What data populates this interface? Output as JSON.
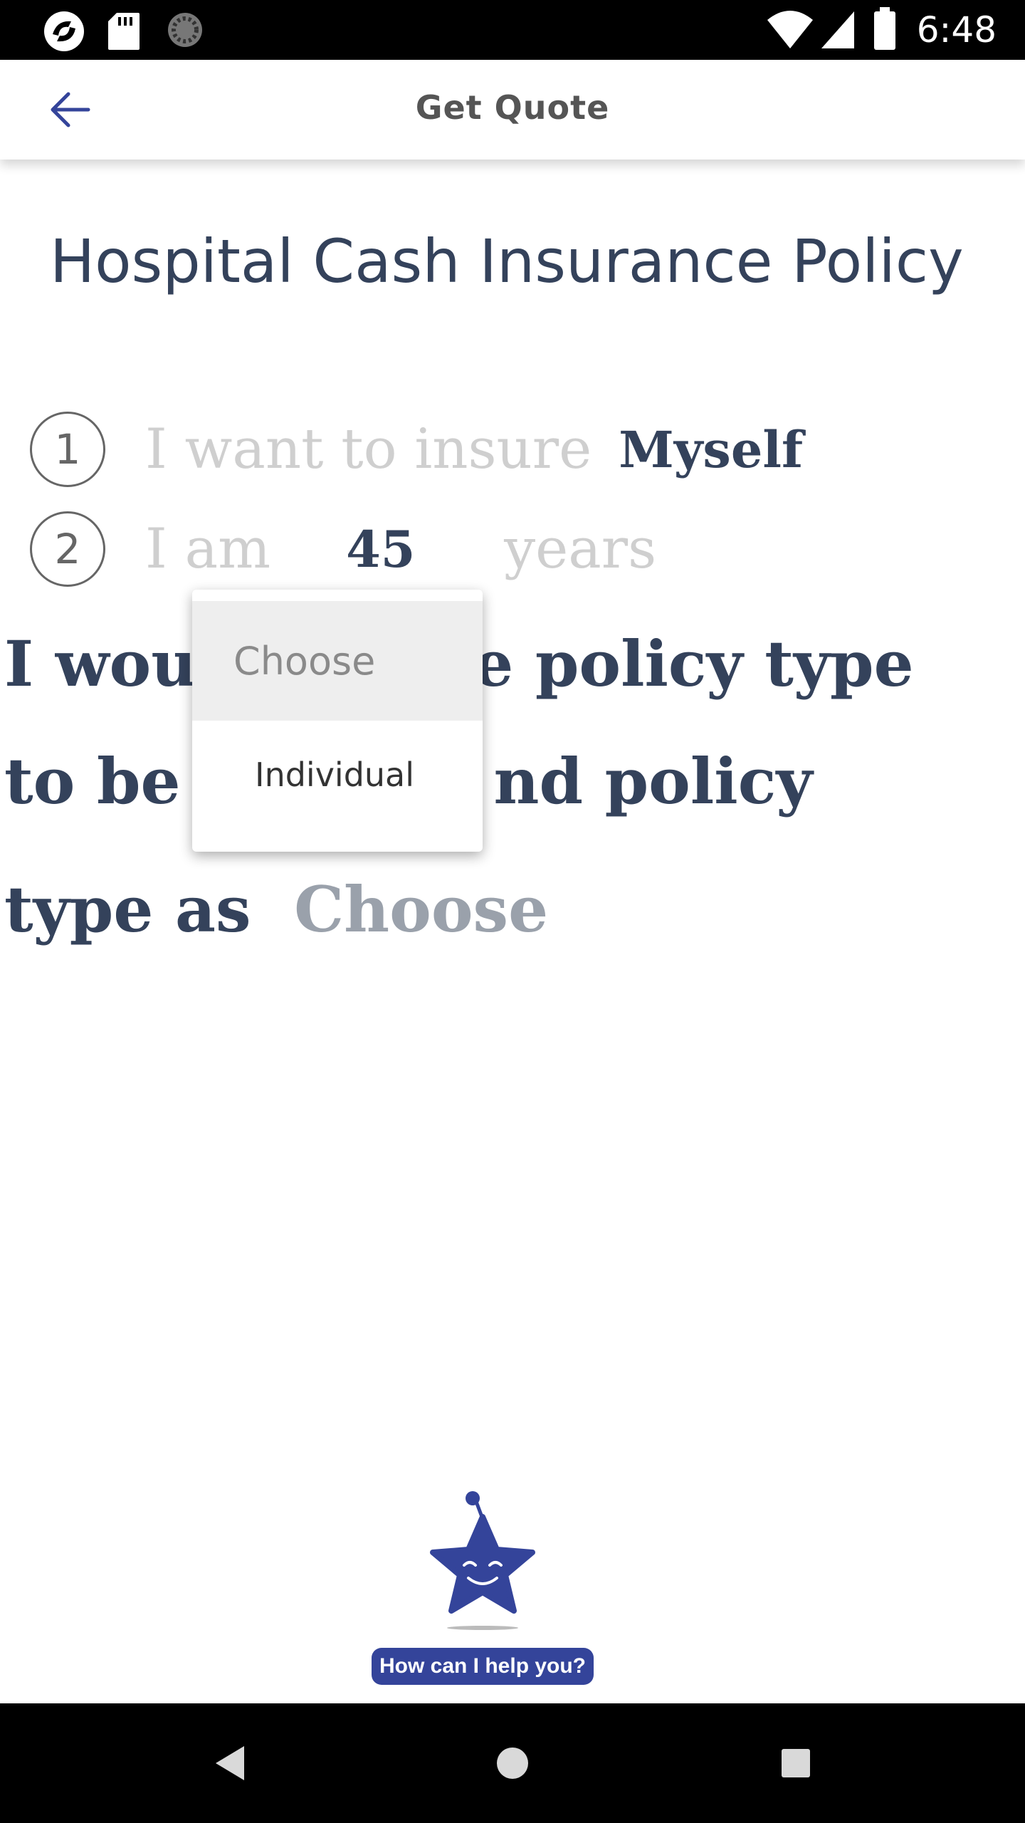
{
  "status_bar": {
    "time": "6:48"
  },
  "app_bar": {
    "title": "Get Quote"
  },
  "page": {
    "title": "Hospital Cash Insurance Policy"
  },
  "steps": [
    {
      "number": "1",
      "prefix": "I want to insure",
      "value": "Myself"
    },
    {
      "number": "2",
      "prefix": "I am",
      "value": "45",
      "suffix": "years"
    }
  ],
  "policy_sentence": {
    "line1_left": "I wou",
    "line1_right": "he policy type",
    "line2_left": "to be",
    "line2_right": "nd policy",
    "line3_left": "type as",
    "choose_value": "Choose"
  },
  "dropdown": {
    "options": [
      "Choose",
      "Individual"
    ]
  },
  "help": {
    "label": "How can I help you?"
  },
  "colors": {
    "primary": "#34449a",
    "text_dark": "#34425b",
    "text_light": "#cfcfcf"
  }
}
